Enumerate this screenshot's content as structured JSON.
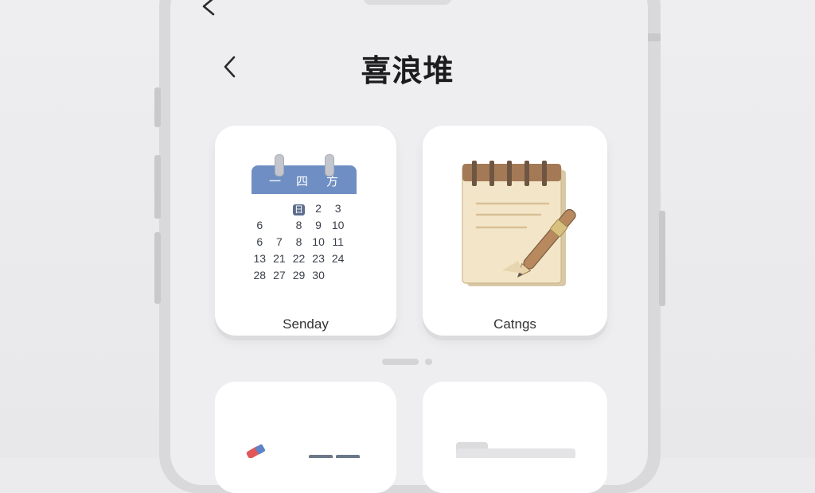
{
  "header": {
    "title": "喜浪堆"
  },
  "cards": [
    {
      "label": "Senday",
      "calendar": {
        "header_labels": [
          "一",
          "四",
          "方"
        ],
        "rows": [
          [
            "",
            "",
            "日",
            "2",
            "3"
          ],
          [
            "6",
            "",
            "8",
            "9",
            "10"
          ],
          [
            "6",
            "7",
            "8",
            "10",
            "11"
          ],
          [
            "13",
            "21",
            "22",
            "23",
            "24"
          ],
          [
            "28",
            "27",
            "29",
            "30",
            ""
          ]
        ]
      }
    },
    {
      "label": "Catngs"
    }
  ],
  "icons": {
    "top_back": "chevron-left-icon",
    "header_back": "chevron-left-icon",
    "card_calendar": "calendar-icon",
    "card_notes": "notepad-pen-icon"
  },
  "colors": {
    "background": "#ebebed",
    "calendar_header": "#6f8fc4",
    "notepad_paper": "#f3e6c8",
    "notepad_binding": "#a47a56"
  }
}
